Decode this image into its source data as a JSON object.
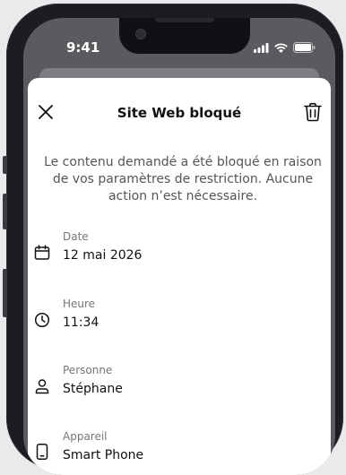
{
  "status_bar": {
    "time": "9:41",
    "icons": [
      "signal-icon",
      "wifi-icon",
      "battery-icon"
    ]
  },
  "sheet": {
    "title": "Site Web bloqué",
    "message": "Le contenu demandé a été bloqué en raison de vos paramètres de restriction. Aucune action n’est nécessaire.",
    "close_icon": "close-icon",
    "delete_icon": "trash-icon"
  },
  "details": [
    {
      "icon": "calendar-icon",
      "label": "Date",
      "value": "12 mai 2026"
    },
    {
      "icon": "clock-icon",
      "label": "Heure",
      "value": "11:34"
    },
    {
      "icon": "person-icon",
      "label": "Personne",
      "value": "Stéphane"
    },
    {
      "icon": "phone-icon",
      "label": "Appareil",
      "value": "Smart Phone"
    }
  ],
  "colors": {
    "background": "#e9eaec",
    "phone_frame": "#1c1d20",
    "sheet": "#ffffff",
    "text_primary": "#111111",
    "text_secondary": "#555555"
  }
}
